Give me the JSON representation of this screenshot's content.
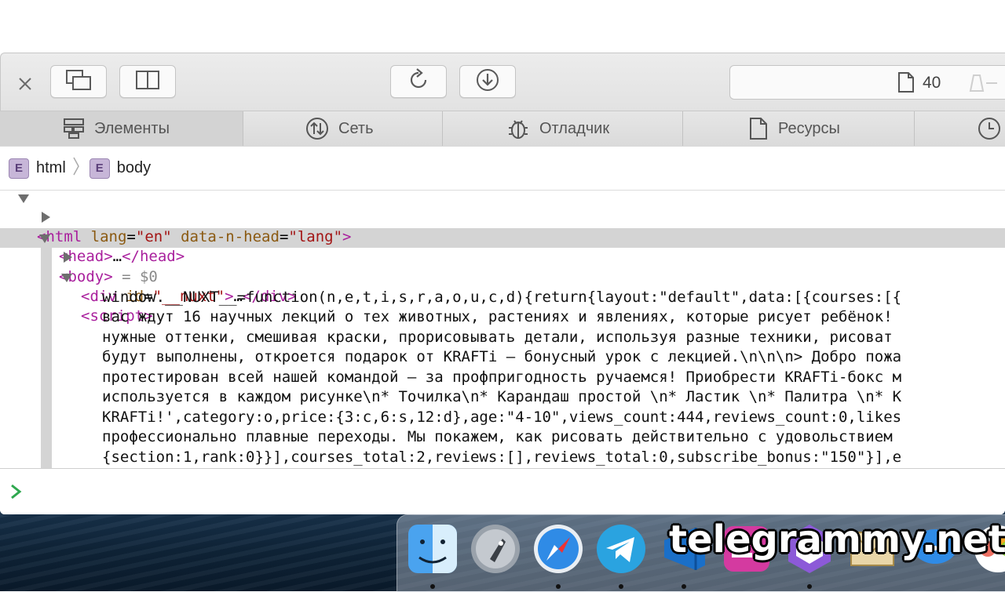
{
  "toolbar": {
    "close_icon": "close-icon",
    "buttons": [
      "dock-mode-icon",
      "split-view-icon",
      "reload-icon",
      "download-icon"
    ],
    "resource_count": "40"
  },
  "tabs": [
    {
      "label": "Элементы",
      "icon": "elements-icon",
      "active": true
    },
    {
      "label": "Сеть",
      "icon": "network-icon",
      "active": false
    },
    {
      "label": "Отладчик",
      "icon": "debugger-icon",
      "active": false
    },
    {
      "label": "Ресурсы",
      "icon": "resources-icon",
      "active": false
    },
    {
      "label": "",
      "icon": "timeline-icon",
      "active": false
    }
  ],
  "breadcrumb": [
    {
      "badge": "E",
      "label": "html"
    },
    {
      "badge": "E",
      "label": "body"
    }
  ],
  "dom": {
    "html_open": "<html",
    "html_attr1": "lang",
    "html_val1": "\"en\"",
    "html_attr2": "data-n-head",
    "html_val2": "\"lang\"",
    "html_close": ">",
    "head": "<head>",
    "head_ellipsis": "…",
    "head_end": "</head>",
    "body": "<body>",
    "body_ref": " = $0",
    "div_open": "<div",
    "div_attr": "id",
    "div_val": "\"__nuxt\"",
    "div_close": ">",
    "div_ellipsis": "…",
    "div_end": "</div>",
    "script": "<script>",
    "script_lines": [
      "window.__NUXT__=function(n,e,t,i,s,r,a,o,u,c,d){return{layout:\"default\",data:[{courses:[{",
      "вас ждут 16 научных лекций о тех животных, растениях и явлениях, которые рисует ребёнок! ",
      "нужные оттенки, смешивая краски, прорисовывать детали, используя разные техники, рисоват",
      "будут выполнены, откроется подарок от KRAFTi — бонусный урок с лекцией.\\n\\n\\n> Добро пожа",
      "протестирован всей нашей командой — за профпригодность ручаемся! Приобрести KRAFTi-бокс м",
      "используется в каждом рисунке\\n* Точилка\\n* Карандаш простой \\n* Ластик \\n* Палитра \\n* К",
      "KRAFTi!',category:o,price:{3:c,6:s,12:d},age:\"4-10\",views_count:444,reviews_count:0,likes",
      "профессионально плавные переходы. Мы покажем, как рисовать действительно с удовольствием ",
      "{section:1,rank:0}}],courses_total:2,reviews:[],reviews_total:0,subscribe_bonus:\"150\"}],e"
    ]
  },
  "console": {
    "prompt_icon": "console-prompt-icon"
  },
  "dock": {
    "apps": [
      "finder-icon",
      "launchpad-icon",
      "safari-icon",
      "telegram-icon",
      "visual-studio-icon",
      "app-icon",
      "app-icon",
      "mail-icon",
      "messages-icon",
      "photos-icon"
    ]
  },
  "watermark": "telegrammy.net"
}
